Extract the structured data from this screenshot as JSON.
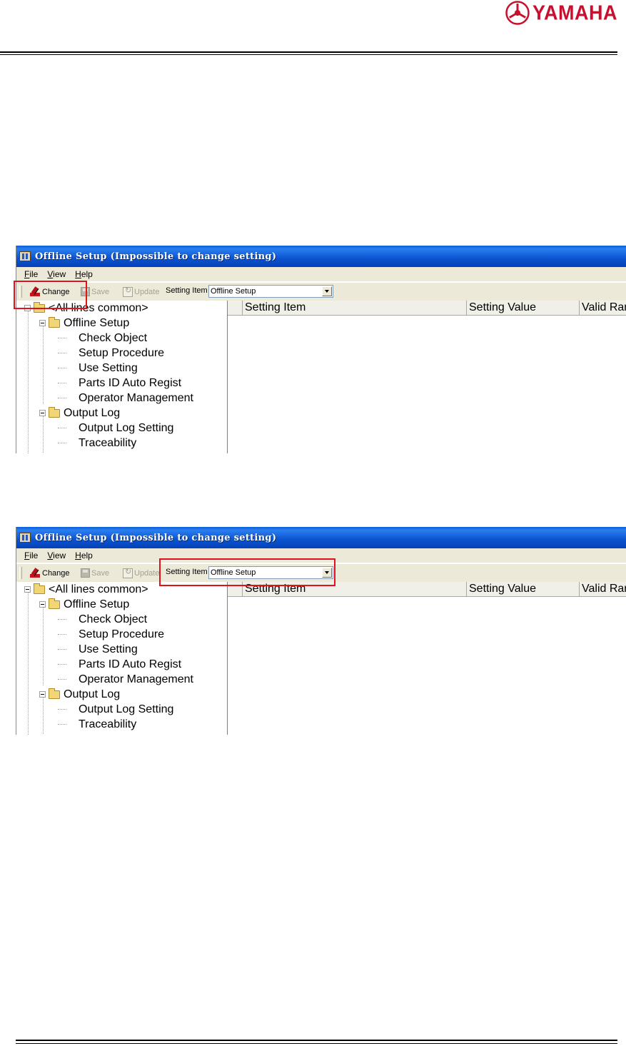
{
  "document": {
    "brand": "YAMAHA"
  },
  "screenshots": [
    {
      "title": "Offline Setup (Impossible to change setting)",
      "menu": [
        {
          "accel": "F",
          "rest": "ile"
        },
        {
          "accel": "V",
          "rest": "iew"
        },
        {
          "accel": "H",
          "rest": "elp"
        }
      ],
      "toolbar": {
        "change": "Change",
        "save": "Save",
        "update": "Update",
        "setting_item_label": "Setting Item",
        "setting_item_value": "Offline Setup"
      },
      "tree": {
        "root": "<All lines common>",
        "groups": [
          {
            "label": "Offline Setup",
            "items": [
              "Check Object",
              "Setup Procedure",
              "Use Setting",
              "Parts ID Auto Regist",
              "Operator Management"
            ]
          },
          {
            "label": "Output Log",
            "items": [
              "Output Log Setting",
              "Traceability"
            ]
          }
        ]
      },
      "grid_headers": [
        "Setting Item",
        "Setting Value",
        "Valid Ran"
      ],
      "highlight": "change-button"
    },
    {
      "title": "Offline Setup (Impossible to change setting)",
      "menu": [
        {
          "accel": "F",
          "rest": "ile"
        },
        {
          "accel": "V",
          "rest": "iew"
        },
        {
          "accel": "H",
          "rest": "elp"
        }
      ],
      "toolbar": {
        "change": "Change",
        "save": "Save",
        "update": "Update",
        "setting_item_label": "Setting Item",
        "setting_item_value": "Offline Setup"
      },
      "tree": {
        "root": "<All lines common>",
        "groups": [
          {
            "label": "Offline Setup",
            "items": [
              "Check Object",
              "Setup Procedure",
              "Use Setting",
              "Parts ID Auto Regist",
              "Operator Management"
            ]
          },
          {
            "label": "Output Log",
            "items": [
              "Output Log Setting",
              "Traceability"
            ]
          }
        ]
      },
      "grid_headers": [
        "Setting Item",
        "Setting Value",
        "Valid Ran"
      ],
      "highlight": "setting-item-combo"
    }
  ]
}
